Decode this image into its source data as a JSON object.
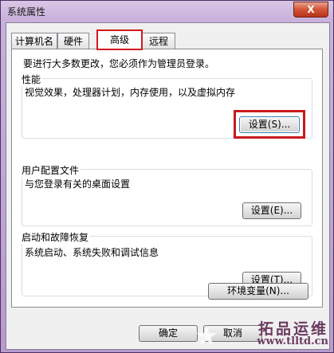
{
  "window": {
    "title": "系统属性",
    "close_label": "X"
  },
  "tabs": [
    {
      "label": "计算机名",
      "active": false
    },
    {
      "label": "硬件",
      "active": false
    },
    {
      "label": "高级",
      "active": true
    },
    {
      "label": "远程",
      "active": false
    }
  ],
  "notice": "要进行大多数更改，您必须作为管理员登录。",
  "groups": {
    "performance": {
      "title": "性能",
      "description": "视觉效果，处理器计划，内存使用，以及虚拟内存",
      "button": "设置(S)..."
    },
    "user_profiles": {
      "title": "用户配置文件",
      "description": "与您登录有关的桌面设置",
      "button": "设置(E)..."
    },
    "startup": {
      "title": "启动和故障恢复",
      "description": "系统启动、系统失败和调试信息",
      "button": "设置(T)..."
    }
  },
  "env_button": "环境变量(N)...",
  "footer": {
    "ok": "确定",
    "cancel": "取消"
  },
  "watermark": {
    "brand": "拓品运维",
    "url": "www.tlltd.cn"
  },
  "colors": {
    "highlight": "#c9181e",
    "accent": "#3c7fb1"
  }
}
